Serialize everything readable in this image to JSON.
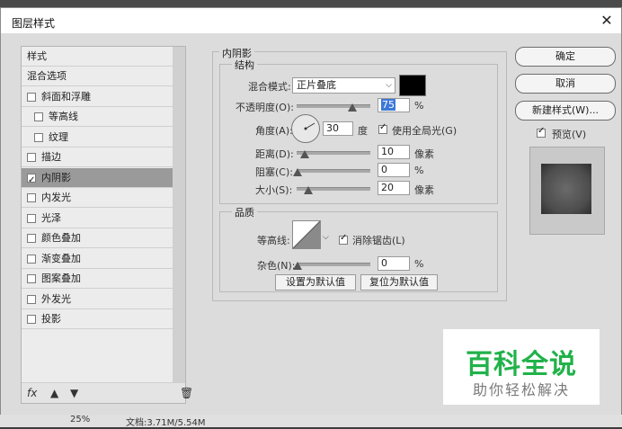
{
  "dialog": {
    "title": "图层样式",
    "close_icon": "close-icon"
  },
  "left_panel": {
    "header": "样式",
    "items": [
      {
        "label": "混合选项",
        "checkbox": false,
        "plus": false,
        "selected": false,
        "indent": false,
        "checked": false
      },
      {
        "label": "斜面和浮雕",
        "checkbox": true,
        "plus": false,
        "selected": false,
        "indent": false,
        "checked": false
      },
      {
        "label": "等高线",
        "checkbox": true,
        "plus": false,
        "selected": false,
        "indent": true,
        "checked": false
      },
      {
        "label": "纹理",
        "checkbox": true,
        "plus": false,
        "selected": false,
        "indent": true,
        "checked": false
      },
      {
        "label": "描边",
        "checkbox": true,
        "plus": true,
        "selected": false,
        "indent": false,
        "checked": false
      },
      {
        "label": "内阴影",
        "checkbox": true,
        "plus": true,
        "selected": true,
        "indent": false,
        "checked": true
      },
      {
        "label": "内发光",
        "checkbox": true,
        "plus": false,
        "selected": false,
        "indent": false,
        "checked": false
      },
      {
        "label": "光泽",
        "checkbox": true,
        "plus": false,
        "selected": false,
        "indent": false,
        "checked": false
      },
      {
        "label": "颜色叠加",
        "checkbox": true,
        "plus": true,
        "selected": false,
        "indent": false,
        "checked": false
      },
      {
        "label": "渐变叠加",
        "checkbox": true,
        "plus": true,
        "selected": false,
        "indent": false,
        "checked": false
      },
      {
        "label": "图案叠加",
        "checkbox": true,
        "plus": false,
        "selected": false,
        "indent": false,
        "checked": false
      },
      {
        "label": "外发光",
        "checkbox": true,
        "plus": false,
        "selected": false,
        "indent": false,
        "checked": false
      },
      {
        "label": "投影",
        "checkbox": true,
        "plus": true,
        "selected": false,
        "indent": false,
        "checked": false
      }
    ],
    "footer": {
      "fx": "fx",
      "up_icon": "arrow-up-icon",
      "down_icon": "arrow-down-icon",
      "trash_icon": "trash-icon"
    }
  },
  "section": {
    "title": "内阴影",
    "structure": {
      "title": "结构",
      "blend_label": "混合模式:",
      "blend_value": "正片叠底",
      "blend_color": "#000000",
      "opacity_label": "不透明度(O):",
      "opacity_value": "75",
      "opacity_unit": "%",
      "opacity_level": 0.75,
      "angle_label": "角度(A):",
      "angle_value": "30",
      "angle_unit": "度",
      "global_light_label": "使用全局光(G)",
      "global_light_checked": true,
      "distance_label": "距离(D):",
      "distance_value": "10",
      "distance_unit": "像素",
      "choke_label": "阻塞(C):",
      "choke_value": "0",
      "choke_unit": "%",
      "size_label": "大小(S):",
      "size_value": "20",
      "size_unit": "像素"
    },
    "quality": {
      "title": "品质",
      "contour_label": "等高线:",
      "antialias_label": "消除锯齿(L)",
      "antialias_checked": true,
      "noise_label": "杂色(N):",
      "noise_value": "0",
      "noise_unit": "%"
    },
    "set_default": "设置为默认值",
    "reset_default": "复位为默认值"
  },
  "right": {
    "ok": "确定",
    "cancel": "取消",
    "new_style": "新建样式(W)...",
    "preview_label": "预览(V)",
    "preview_checked": true
  },
  "status": {
    "zoom": "25%",
    "doc": "文档:3.71M/5.54M"
  },
  "watermark": {
    "big": "百科全说",
    "small": "助你轻松解决"
  }
}
